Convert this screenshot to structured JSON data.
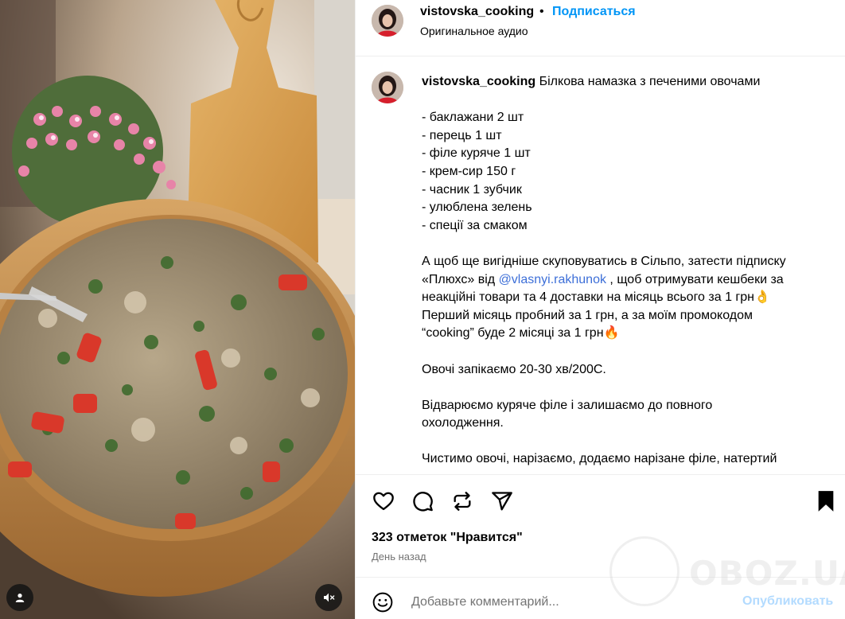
{
  "post": {
    "username": "vistovska_cooking",
    "dot": "•",
    "follow_label": "Подписаться",
    "audio_label": "Оригинальное аудио"
  },
  "caption": {
    "username": "vistovska_cooking",
    "title": "Білкова намазка з печеними овочами",
    "ingredients": [
      "- баклажани 2 шт",
      "- перець 1 шт",
      "- філе куряче 1 шт",
      "- крем-сир 150 г",
      "- часник 1 зубчик",
      "- улюблена зелень",
      "- спеції за смаком"
    ],
    "promo_line1": "А щоб ще вигідніше скуповуватись в Сільпо, затести підписку",
    "promo_line2_pre": "«Плюхс» від ",
    "promo_mention": "@vlasnyi.rakhunok",
    "promo_line2_post": " , щоб отримувати кешбеки за",
    "promo_line3": "неакційні товари та 4 доставки на місяць всього за 1 грн👌",
    "promo_line4": "Перший місяць пробний за 1 грн, а за моїм промокодом",
    "promo_line5": "“cooking” буде 2 місяці за 1 грн🔥",
    "step1": "Овочі запікаємо 20-30 хв/200С.",
    "step2_line1": "Відварюємо куряче філе і залишаємо до повного",
    "step2_line2": "охолодження.",
    "step3_line1": "Чистимо овочі, нарізаємо, додаємо нарізане філе, натертий"
  },
  "actions": {
    "icons": [
      "heart-icon",
      "comment-icon",
      "repost-icon",
      "share-icon",
      "bookmark-icon"
    ]
  },
  "likes_text": "323 отметок \"Нравится\"",
  "time_ago": "День назад",
  "comment_box": {
    "placeholder": "Добавьте комментарий...",
    "publish_label": "Опубликовать"
  },
  "watermark": "OBOZ.UA",
  "colors": {
    "accent": "#0095f6",
    "publish_disabled": "#b3dbff",
    "muted": "#737373",
    "mention": "#3d6fd8"
  }
}
